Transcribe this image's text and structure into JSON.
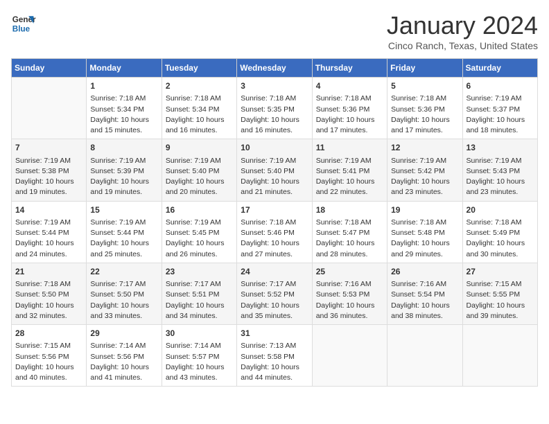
{
  "header": {
    "logo_line1": "General",
    "logo_line2": "Blue",
    "title": "January 2024",
    "subtitle": "Cinco Ranch, Texas, United States"
  },
  "days_of_week": [
    "Sunday",
    "Monday",
    "Tuesday",
    "Wednesday",
    "Thursday",
    "Friday",
    "Saturday"
  ],
  "weeks": [
    [
      {
        "day": "",
        "info": ""
      },
      {
        "day": "1",
        "info": "Sunrise: 7:18 AM\nSunset: 5:34 PM\nDaylight: 10 hours\nand 15 minutes."
      },
      {
        "day": "2",
        "info": "Sunrise: 7:18 AM\nSunset: 5:34 PM\nDaylight: 10 hours\nand 16 minutes."
      },
      {
        "day": "3",
        "info": "Sunrise: 7:18 AM\nSunset: 5:35 PM\nDaylight: 10 hours\nand 16 minutes."
      },
      {
        "day": "4",
        "info": "Sunrise: 7:18 AM\nSunset: 5:36 PM\nDaylight: 10 hours\nand 17 minutes."
      },
      {
        "day": "5",
        "info": "Sunrise: 7:18 AM\nSunset: 5:36 PM\nDaylight: 10 hours\nand 17 minutes."
      },
      {
        "day": "6",
        "info": "Sunrise: 7:19 AM\nSunset: 5:37 PM\nDaylight: 10 hours\nand 18 minutes."
      }
    ],
    [
      {
        "day": "7",
        "info": "Sunrise: 7:19 AM\nSunset: 5:38 PM\nDaylight: 10 hours\nand 19 minutes."
      },
      {
        "day": "8",
        "info": "Sunrise: 7:19 AM\nSunset: 5:39 PM\nDaylight: 10 hours\nand 19 minutes."
      },
      {
        "day": "9",
        "info": "Sunrise: 7:19 AM\nSunset: 5:40 PM\nDaylight: 10 hours\nand 20 minutes."
      },
      {
        "day": "10",
        "info": "Sunrise: 7:19 AM\nSunset: 5:40 PM\nDaylight: 10 hours\nand 21 minutes."
      },
      {
        "day": "11",
        "info": "Sunrise: 7:19 AM\nSunset: 5:41 PM\nDaylight: 10 hours\nand 22 minutes."
      },
      {
        "day": "12",
        "info": "Sunrise: 7:19 AM\nSunset: 5:42 PM\nDaylight: 10 hours\nand 23 minutes."
      },
      {
        "day": "13",
        "info": "Sunrise: 7:19 AM\nSunset: 5:43 PM\nDaylight: 10 hours\nand 23 minutes."
      }
    ],
    [
      {
        "day": "14",
        "info": "Sunrise: 7:19 AM\nSunset: 5:44 PM\nDaylight: 10 hours\nand 24 minutes."
      },
      {
        "day": "15",
        "info": "Sunrise: 7:19 AM\nSunset: 5:44 PM\nDaylight: 10 hours\nand 25 minutes."
      },
      {
        "day": "16",
        "info": "Sunrise: 7:19 AM\nSunset: 5:45 PM\nDaylight: 10 hours\nand 26 minutes."
      },
      {
        "day": "17",
        "info": "Sunrise: 7:18 AM\nSunset: 5:46 PM\nDaylight: 10 hours\nand 27 minutes."
      },
      {
        "day": "18",
        "info": "Sunrise: 7:18 AM\nSunset: 5:47 PM\nDaylight: 10 hours\nand 28 minutes."
      },
      {
        "day": "19",
        "info": "Sunrise: 7:18 AM\nSunset: 5:48 PM\nDaylight: 10 hours\nand 29 minutes."
      },
      {
        "day": "20",
        "info": "Sunrise: 7:18 AM\nSunset: 5:49 PM\nDaylight: 10 hours\nand 30 minutes."
      }
    ],
    [
      {
        "day": "21",
        "info": "Sunrise: 7:18 AM\nSunset: 5:50 PM\nDaylight: 10 hours\nand 32 minutes."
      },
      {
        "day": "22",
        "info": "Sunrise: 7:17 AM\nSunset: 5:50 PM\nDaylight: 10 hours\nand 33 minutes."
      },
      {
        "day": "23",
        "info": "Sunrise: 7:17 AM\nSunset: 5:51 PM\nDaylight: 10 hours\nand 34 minutes."
      },
      {
        "day": "24",
        "info": "Sunrise: 7:17 AM\nSunset: 5:52 PM\nDaylight: 10 hours\nand 35 minutes."
      },
      {
        "day": "25",
        "info": "Sunrise: 7:16 AM\nSunset: 5:53 PM\nDaylight: 10 hours\nand 36 minutes."
      },
      {
        "day": "26",
        "info": "Sunrise: 7:16 AM\nSunset: 5:54 PM\nDaylight: 10 hours\nand 38 minutes."
      },
      {
        "day": "27",
        "info": "Sunrise: 7:15 AM\nSunset: 5:55 PM\nDaylight: 10 hours\nand 39 minutes."
      }
    ],
    [
      {
        "day": "28",
        "info": "Sunrise: 7:15 AM\nSunset: 5:56 PM\nDaylight: 10 hours\nand 40 minutes."
      },
      {
        "day": "29",
        "info": "Sunrise: 7:14 AM\nSunset: 5:56 PM\nDaylight: 10 hours\nand 41 minutes."
      },
      {
        "day": "30",
        "info": "Sunrise: 7:14 AM\nSunset: 5:57 PM\nDaylight: 10 hours\nand 43 minutes."
      },
      {
        "day": "31",
        "info": "Sunrise: 7:13 AM\nSunset: 5:58 PM\nDaylight: 10 hours\nand 44 minutes."
      },
      {
        "day": "",
        "info": ""
      },
      {
        "day": "",
        "info": ""
      },
      {
        "day": "",
        "info": ""
      }
    ]
  ]
}
